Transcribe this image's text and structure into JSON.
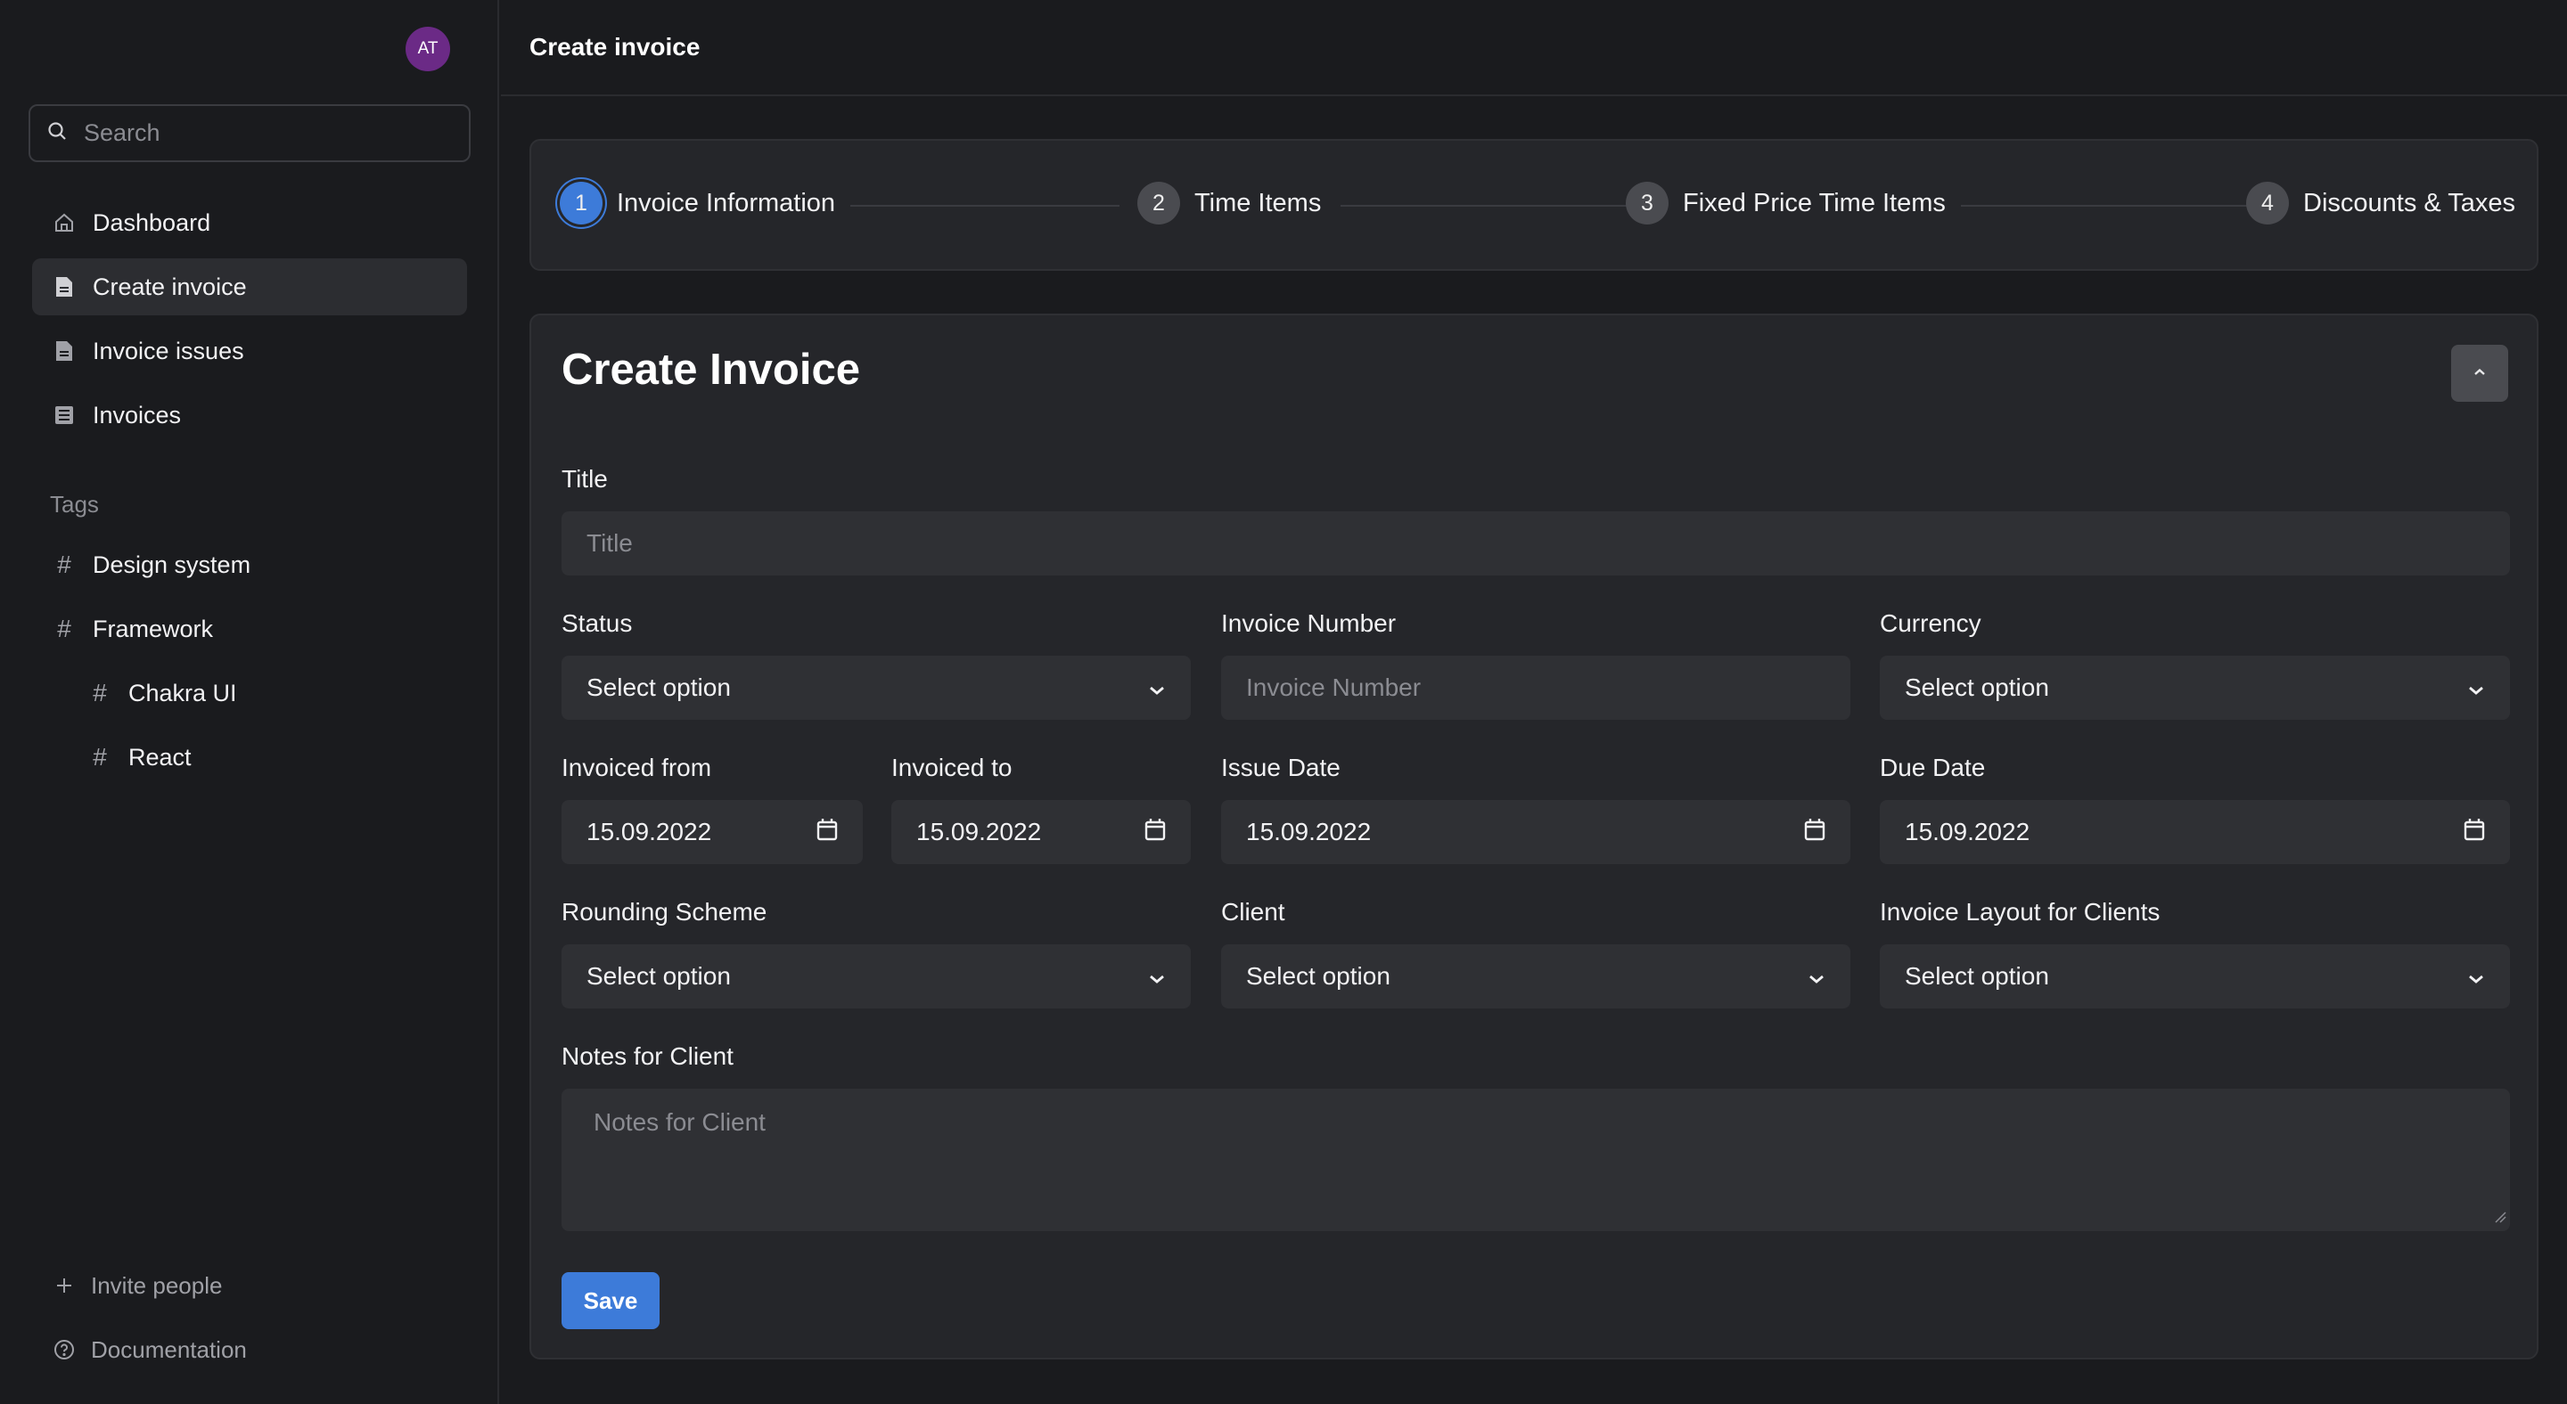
{
  "user": {
    "initials": "AT"
  },
  "search": {
    "placeholder": "Search"
  },
  "sidebar": {
    "items": [
      {
        "label": "Dashboard",
        "icon": "home-icon"
      },
      {
        "label": "Create invoice",
        "icon": "document-icon",
        "active": true
      },
      {
        "label": "Invoice issues",
        "icon": "document-icon"
      },
      {
        "label": "Invoices",
        "icon": "list-icon"
      }
    ],
    "tags_title": "Tags",
    "tags": [
      {
        "label": "Design system"
      },
      {
        "label": "Framework"
      },
      {
        "label": "Chakra UI"
      },
      {
        "label": "React"
      }
    ],
    "footer": [
      {
        "label": "Invite people",
        "icon": "plus-icon"
      },
      {
        "label": "Documentation",
        "icon": "help-circle-icon"
      }
    ]
  },
  "header": {
    "title": "Create invoice"
  },
  "stepper": {
    "steps": [
      {
        "number": "1",
        "label": "Invoice Information",
        "active": true
      },
      {
        "number": "2",
        "label": "Time Items"
      },
      {
        "number": "3",
        "label": "Fixed Price Time Items"
      },
      {
        "number": "4",
        "label": "Discounts & Taxes"
      }
    ]
  },
  "form": {
    "heading": "Create Invoice",
    "title": {
      "label": "Title",
      "placeholder": "Title"
    },
    "status": {
      "label": "Status",
      "value": "Select option"
    },
    "invoice_number": {
      "label": "Invoice Number",
      "placeholder": "Invoice Number"
    },
    "currency": {
      "label": "Currency",
      "value": "Select option"
    },
    "invoiced_from": {
      "label": "Invoiced from",
      "value": "15.09.2022"
    },
    "invoiced_to": {
      "label": "Invoiced to",
      "value": "15.09.2022"
    },
    "issue_date": {
      "label": "Issue Date",
      "value": "15.09.2022"
    },
    "due_date": {
      "label": "Due Date",
      "value": "15.09.2022"
    },
    "rounding_scheme": {
      "label": "Rounding Scheme",
      "value": "Select option"
    },
    "client": {
      "label": "Client",
      "value": "Select option"
    },
    "invoice_layout": {
      "label": "Invoice Layout for Clients",
      "value": "Select option"
    },
    "notes": {
      "label": "Notes for Client",
      "placeholder": "Notes for Client"
    },
    "save_label": "Save"
  },
  "colors": {
    "background": "#1a1b1e",
    "card": "#25262a",
    "input": "#2f3034",
    "accent": "#3d7bd9",
    "avatar": "#6b2a86"
  }
}
